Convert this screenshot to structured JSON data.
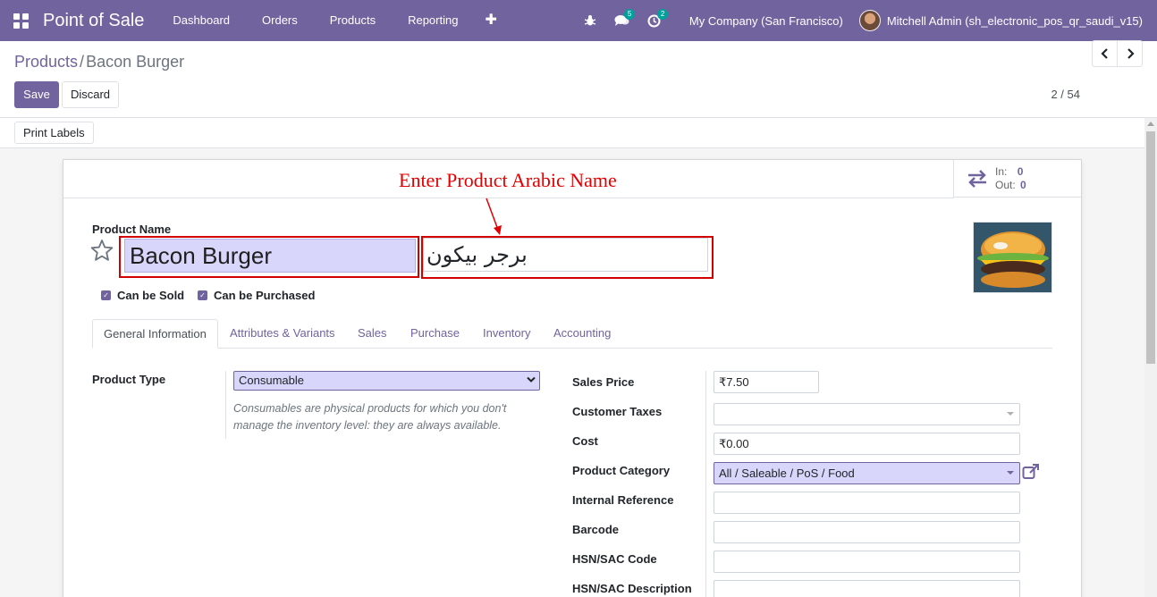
{
  "navbar": {
    "app_title": "Point of Sale",
    "menu": [
      "Dashboard",
      "Orders",
      "Products",
      "Reporting"
    ],
    "plus": "✚",
    "bug_icon": "bug-icon",
    "messages_count": "5",
    "activities_count": "2",
    "company": "My Company (San Francisco)",
    "user": "Mitchell Admin (sh_electronic_pos_qr_saudi_v15)",
    "accent_color": "#71639e"
  },
  "breadcrumb": {
    "parent": "Products",
    "separator": "/",
    "current": "Bacon Burger"
  },
  "actions": {
    "save": "Save",
    "discard": "Discard",
    "print_labels": "Print Labels"
  },
  "pager": {
    "value": "2 / 54",
    "prev": "‹",
    "next": "›"
  },
  "stat_button": {
    "in_label": "In:",
    "in_value": "0",
    "out_label": "Out:",
    "out_value": "0"
  },
  "annotation": {
    "text": "Enter Product Arabic Name",
    "color": "#e30000"
  },
  "form": {
    "product_name_label": "Product Name",
    "product_name": "Bacon Burger",
    "arabic_name": "برجر بيكون",
    "can_be_sold": "Can be Sold",
    "can_be_purchased": "Can be Purchased",
    "tabs": [
      "General Information",
      "Attributes & Variants",
      "Sales",
      "Purchase",
      "Inventory",
      "Accounting"
    ],
    "product_type_label": "Product Type",
    "product_type": "Consumable",
    "product_type_help": "Consumables are physical products for which you don't manage the inventory level: they are always available.",
    "sales_price_label": "Sales Price",
    "sales_price": "₹7.50",
    "customer_taxes_label": "Customer Taxes",
    "customer_taxes": "",
    "cost_label": "Cost",
    "cost": "₹0.00",
    "category_label": "Product Category",
    "category": "All / Saleable / PoS / Food",
    "internal_ref_label": "Internal Reference",
    "internal_ref": "",
    "barcode_label": "Barcode",
    "barcode": "",
    "hsn_code_label": "HSN/SAC Code",
    "hsn_code": "",
    "hsn_desc_label": "HSN/SAC Description",
    "hsn_desc": ""
  }
}
